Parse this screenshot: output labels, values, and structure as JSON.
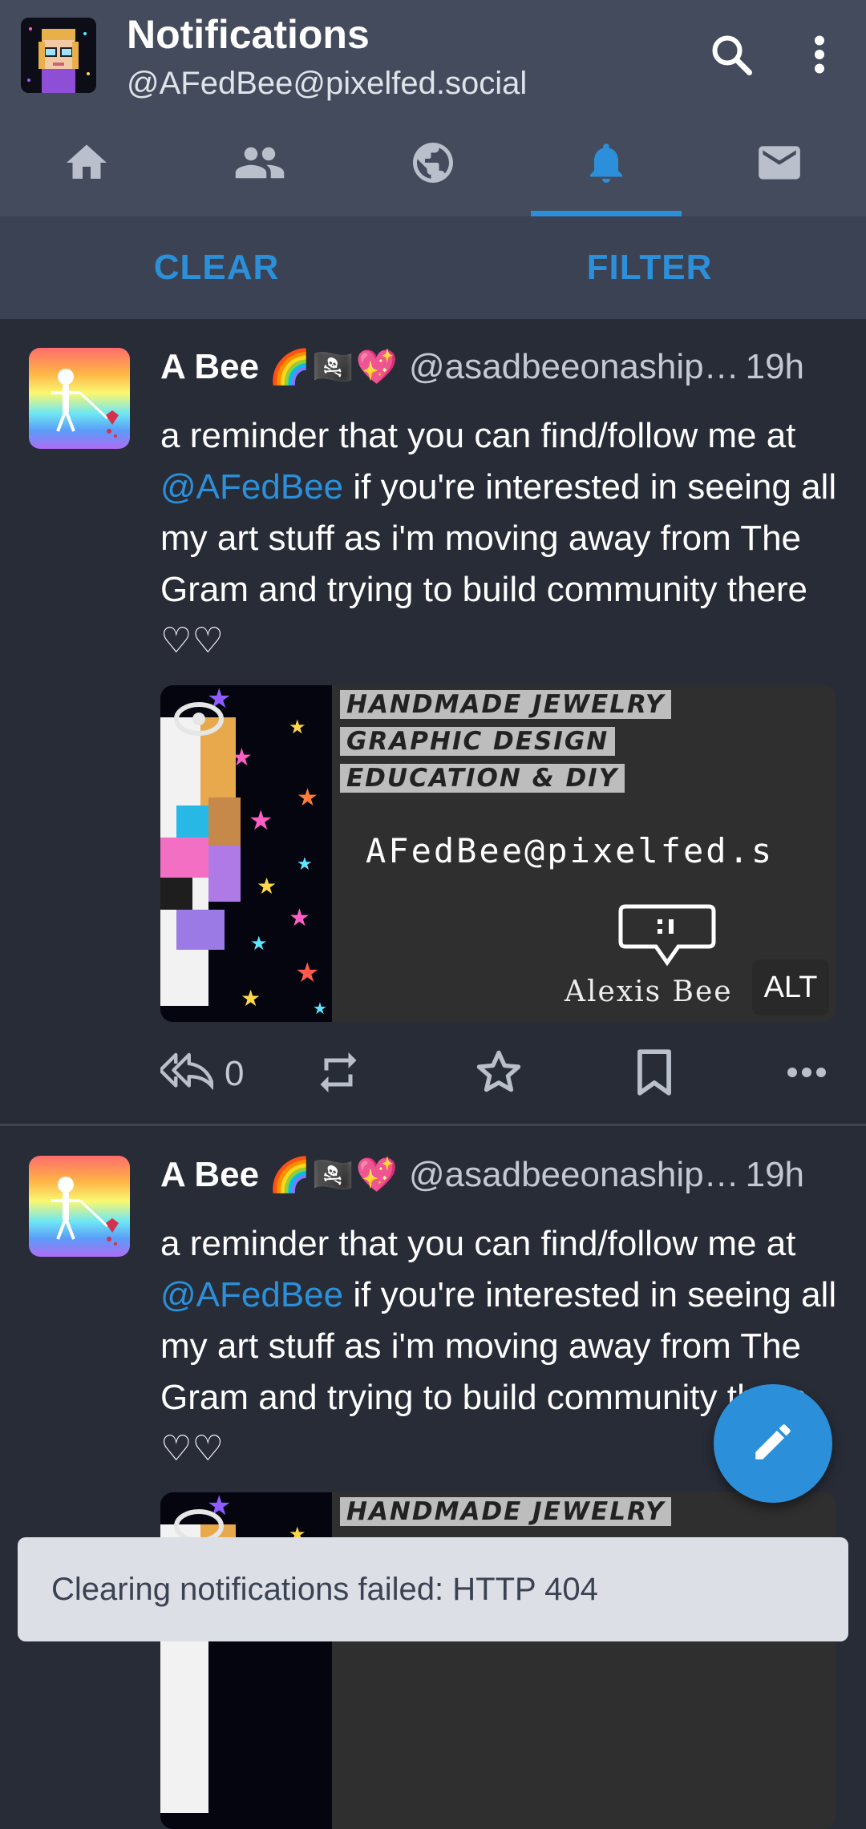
{
  "header": {
    "title": "Notifications",
    "account": "@AFedBee@pixelfed.social",
    "icons": [
      "search-icon",
      "more-vert-icon"
    ]
  },
  "tabs": [
    {
      "icon": "home-icon",
      "active": false
    },
    {
      "icon": "people-icon",
      "active": false
    },
    {
      "icon": "globe-icon",
      "active": false
    },
    {
      "icon": "bell-icon",
      "active": true
    },
    {
      "icon": "mail-icon",
      "active": false
    }
  ],
  "actions": {
    "clear": "CLEAR",
    "filter": "FILTER"
  },
  "statuses": [
    {
      "name": "A Bee",
      "emojis": [
        "🌈",
        "🏴‍☠️",
        "💖"
      ],
      "handle": "@asadbeeonaship…",
      "time": "19h",
      "text_before": "a reminder that you can find/follow me at ",
      "mention": "@AFedBee",
      "text_after": " if you're interested in seeing all my art stuff as i'm moving away from The Gram and trying to build community there ♡♡",
      "media": {
        "lines": [
          "HANDMADE JEWELRY",
          "GRAPHIC DESIGN",
          "EDUCATION & DIY"
        ],
        "handle": "AFedBee@pixelfed.s",
        "signature": "Alexis Bee",
        "alt_label": "ALT"
      },
      "reply_count": "0"
    },
    {
      "name": "A Bee",
      "emojis": [
        "🌈",
        "🏴‍☠️",
        "💖"
      ],
      "handle": "@asadbeeonaship…",
      "time": "19h",
      "text_before": "a reminder that you can find/follow me at ",
      "mention": "@AFedBee",
      "text_after": " if you're interested in seeing all my art stuff as i'm moving away from The Gram and trying to build community there ♡♡",
      "media": {
        "lines": [
          "HANDMADE JEWELRY"
        ]
      }
    }
  ],
  "snackbar": "Clearing notifications failed: HTTP 404",
  "colors": {
    "accent": "#2b90d9",
    "background": "#282c37",
    "toolbar": "#444b5d",
    "actionbar": "#3b4253"
  }
}
